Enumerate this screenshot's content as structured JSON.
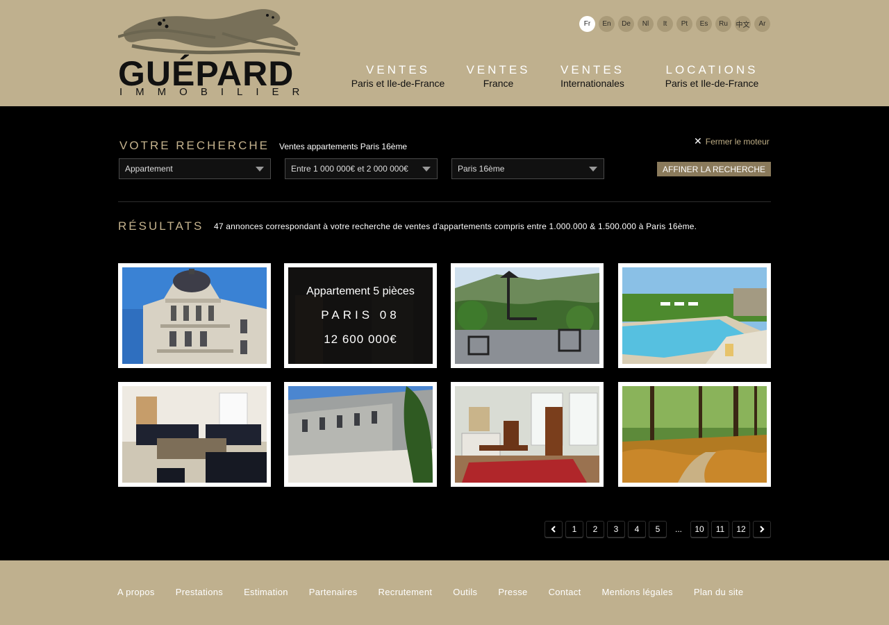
{
  "brand": {
    "name": "GUÉPARD",
    "subtitle": "IMMOBILIER"
  },
  "languages": [
    "Fr",
    "En",
    "De",
    "Nl",
    "It",
    "Pt",
    "Es",
    "Ru",
    "中文",
    "Ar"
  ],
  "active_language": "Fr",
  "nav": [
    {
      "top": "VENTES",
      "bottom": "Paris et Ile-de-France"
    },
    {
      "top": "VENTES",
      "bottom": "France"
    },
    {
      "top": "VENTES",
      "bottom": "Internationales"
    },
    {
      "top": "LOCATIONS",
      "bottom": "Paris et Ile-de-France"
    }
  ],
  "search": {
    "title": "VOTRE RECHERCHE",
    "description": "Ventes appartements Paris 16ème",
    "close_label": "Fermer le moteur",
    "type_value": "Appartement",
    "price_value": "Entre 1 000 000€ et 2 000 000€",
    "location_value": "Paris 16ème",
    "refine_label": "AFFINER LA RECHERCHE"
  },
  "results": {
    "title": "RÉSULTATS",
    "description": "47 annonces correspondant à votre recherche de ventes d'appartements compris entre 1.000.000 & 1.500.000 à Paris 16ème."
  },
  "listings": [
    {
      "scene": "haussmann-building"
    },
    {
      "scene": "overlay",
      "type": "Appartement 5 pièces",
      "city": "PARIS 08",
      "price": "12 600 000€"
    },
    {
      "scene": "terrace-valley"
    },
    {
      "scene": "pool-garden"
    },
    {
      "scene": "living-room"
    },
    {
      "scene": "stone-courtyard"
    },
    {
      "scene": "antique-salon"
    },
    {
      "scene": "forest-path"
    }
  ],
  "pagination": {
    "prev_icon": "chevron-left-icon",
    "pages": [
      "1",
      "2",
      "3",
      "4",
      "5",
      "...",
      "10",
      "11",
      "12"
    ],
    "next_icon": "chevron-right-icon"
  },
  "footer_links": [
    "A propos",
    "Prestations",
    "Estimation",
    "Partenaires",
    "Recrutement",
    "Outils",
    "Presse",
    "Contact",
    "Mentions légales",
    "Plan du site"
  ],
  "colors": {
    "header_bg": "#bfb08e",
    "accent_gold": "#c5b38e",
    "button_bg": "#8a7a5b"
  }
}
